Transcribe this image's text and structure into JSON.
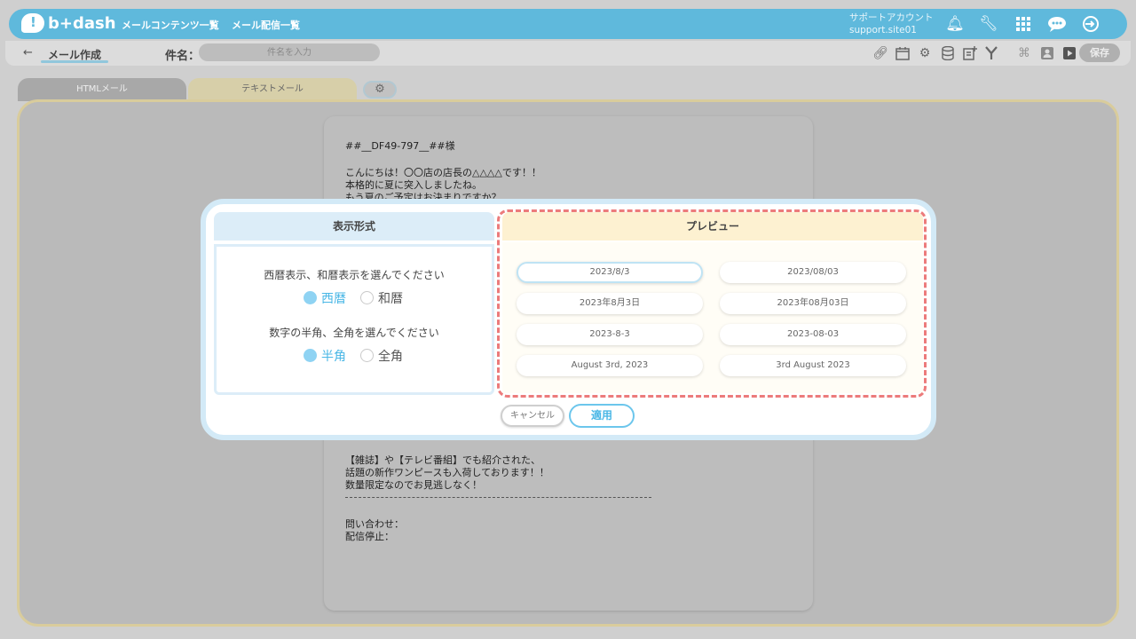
{
  "header": {
    "logo_text": "b+dash",
    "nav": [
      "メールコンテンツ一覧",
      "メール配信一覧"
    ],
    "account_label": "サポートアカウント",
    "account_id": "support.site01",
    "icons": [
      "bell-icon",
      "wrench-icon",
      "grid-icon",
      "chat-icon",
      "logout-icon"
    ]
  },
  "toolbar": {
    "back_icon": "←",
    "page_title": "メール作成",
    "subject_label": "件名：",
    "subject_placeholder": "件名を入力",
    "save_label": "保存",
    "tool_icons": [
      "link-icon",
      "calendar-icon",
      "gear-cluster-icon",
      "database-icon",
      "add-document-icon",
      "branch-icon",
      "image-icon",
      "profile-icon",
      "play-icon"
    ]
  },
  "tabs": {
    "html": "HTMLメール",
    "text": "テキストメール",
    "settings_icon": "gear-icon"
  },
  "editor": {
    "lines": [
      "##__DF49-797__##様",
      "",
      "こんにちは！〇〇店の店長の△△△△です！！",
      "本格的に夏に突入しましたね。",
      "もう夏のご予定はお決まりですか？"
    ],
    "lines_bottom": [
      "【雑誌】や【テレビ番組】でも紹介された、",
      "話題の新作ワンピースも入荷しております！！",
      "数量限定なのでお見逃しなく！",
      "--------------------------------------------------------------------------",
      "",
      "問い合わせ：",
      "配信停止："
    ]
  },
  "modal": {
    "left_title": "表示形式",
    "right_title": "プレビュー",
    "era_question": "西暦表示、和暦表示を選んでください",
    "era_options": [
      "西暦",
      "和暦"
    ],
    "era_selected": "西暦",
    "width_question": "数字の半角、全角を選んでください",
    "width_options": [
      "半角",
      "全角"
    ],
    "width_selected": "半角",
    "formats": [
      "2023/8/3",
      "2023/08/03",
      "2023年8月3日",
      "2023年08月03日",
      "2023-8-3",
      "2023-08-03",
      "August 3rd, 2023",
      "3rd August 2023"
    ],
    "selected_format": "2023/8/3",
    "cancel_label": "キャンセル",
    "apply_label": "適用"
  },
  "colors": {
    "accent": "#5fb9dc",
    "highlight_dash": "#ec7b7b",
    "preview_header": "#fdf1d1"
  }
}
